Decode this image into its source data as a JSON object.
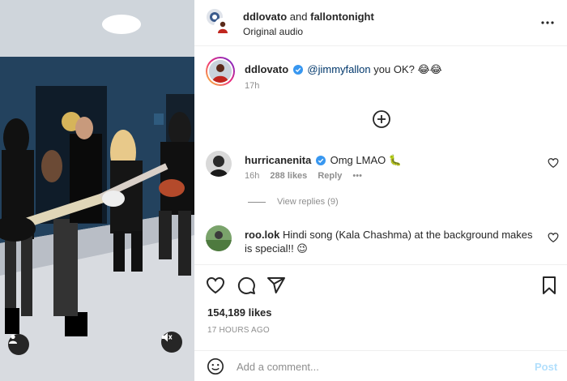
{
  "post": {
    "header": {
      "user1": "ddlovato",
      "joiner": "and",
      "user2": "fallontonight",
      "audio": "Original audio"
    },
    "caption": {
      "username": "ddlovato",
      "mention": "@jimmyfallon",
      "text": "you OK? 😂😂",
      "time": "17h"
    },
    "comments": [
      {
        "username": "hurricanenita",
        "verified": true,
        "text": "Omg LMAO 🐛",
        "time": "16h",
        "likes": "288 likes",
        "reply": "Reply",
        "more": "•••",
        "view_replies": "View replies (9)"
      },
      {
        "username": "roo.lok",
        "verified": false,
        "text": "Hindi song (Kala Chashma) at the background makes is special!! 😉"
      }
    ],
    "likes": "154,189 likes",
    "posted_ago": "17 HOURS AGO",
    "add_comment": {
      "placeholder": "Add a comment...",
      "post_label": "Post"
    }
  },
  "icons": {
    "more": "more-icon",
    "add": "add-circle-icon",
    "like": "heart-icon",
    "comment": "comment-icon",
    "share": "share-icon",
    "save": "bookmark-icon",
    "emoji": "emoji-icon",
    "user": "user-icon",
    "mute": "muted-speaker-icon"
  },
  "colors": {
    "verified": "#3897f0",
    "mention": "#00376b",
    "secondary_text": "#8e8e8e",
    "post_disabled": "#b2dffc"
  }
}
